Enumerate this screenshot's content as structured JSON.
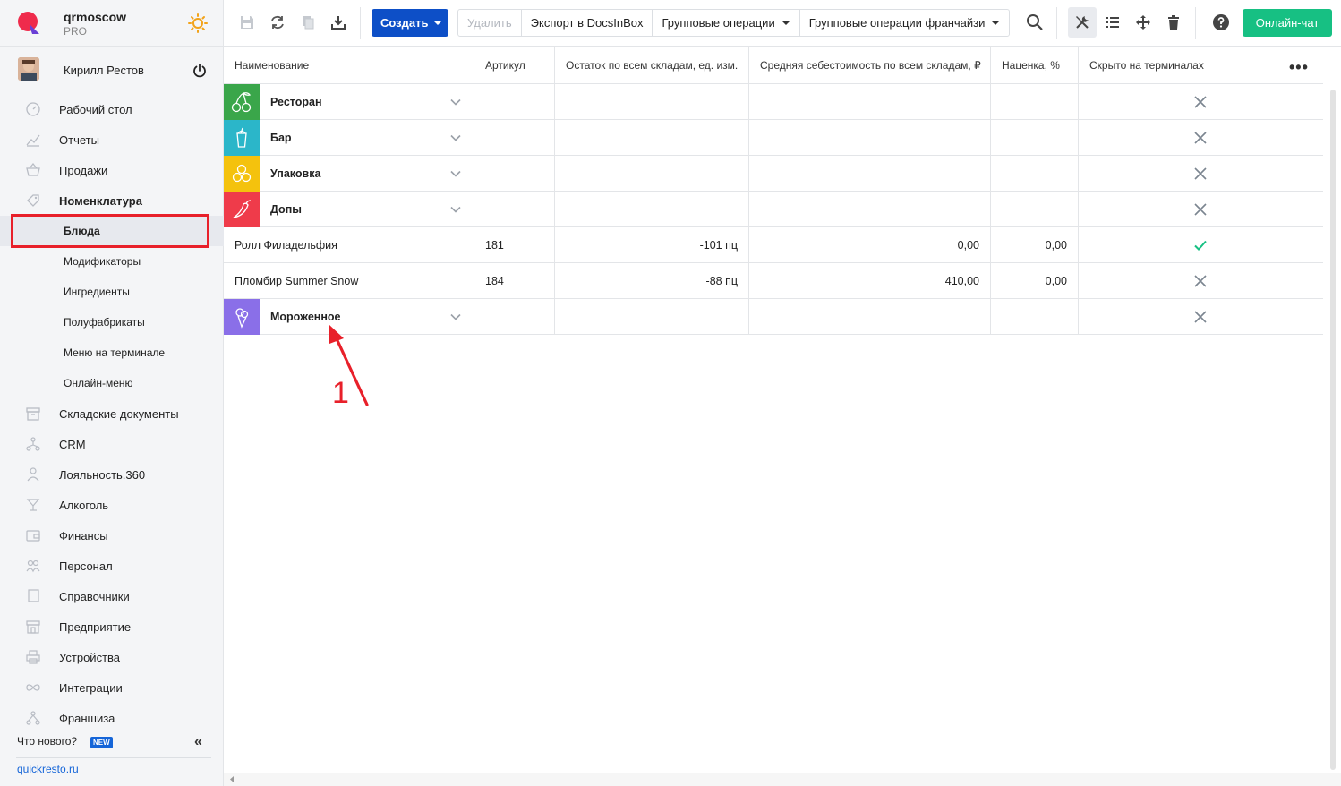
{
  "brand": {
    "name": "qrmoscow",
    "plan": "PRO"
  },
  "user": {
    "name": "Кирилл Рестов"
  },
  "nav": {
    "items": [
      {
        "label": "Рабочий стол",
        "icon": "dashboard-icon"
      },
      {
        "label": "Отчеты",
        "icon": "reports-icon"
      },
      {
        "label": "Продажи",
        "icon": "basket-icon"
      },
      {
        "label": "Номенклатура",
        "icon": "tag-icon"
      }
    ],
    "sub_items": [
      {
        "label": "Блюда"
      },
      {
        "label": "Модификаторы"
      },
      {
        "label": "Ингредиенты"
      },
      {
        "label": "Полуфабрикаты"
      },
      {
        "label": "Меню на терминале"
      },
      {
        "label": "Онлайн-меню"
      }
    ],
    "items2": [
      {
        "label": "Складские документы",
        "icon": "warehouse-icon"
      },
      {
        "label": "CRM",
        "icon": "crm-icon"
      },
      {
        "label": "Лояльность.360",
        "icon": "loyalty-icon"
      },
      {
        "label": "Алкоголь",
        "icon": "glass-icon"
      },
      {
        "label": "Финансы",
        "icon": "wallet-icon"
      },
      {
        "label": "Персонал",
        "icon": "staff-icon"
      },
      {
        "label": "Справочники",
        "icon": "book-icon"
      },
      {
        "label": "Предприятие",
        "icon": "store-icon"
      },
      {
        "label": "Устройства",
        "icon": "printer-icon"
      },
      {
        "label": "Интеграции",
        "icon": "infinity-icon"
      },
      {
        "label": "Франшиза",
        "icon": "franchise-icon"
      }
    ],
    "whats_new": "Что нового?",
    "new_badge": "NEW",
    "site": "quickresto.ru"
  },
  "toolbar": {
    "create": "Создать",
    "delete": "Удалить",
    "export": "Экспорт в DocsInBox",
    "group_ops": "Групповые операции",
    "group_ops_franchise": "Групповые операции франчайзи",
    "chat": "Онлайн-чат"
  },
  "table": {
    "headers": {
      "name": "Наименование",
      "article": "Артикул",
      "stock": "Остаток по всем складам, ед. изм.",
      "cost": "Средняя себестоимость по всем складам, ₽",
      "markup": "Наценка, %",
      "hidden": "Скрыто на терминалах"
    },
    "rows": [
      {
        "type": "category",
        "name": "Ресторан",
        "color": "#3aa64a",
        "icon": "cherries-icon",
        "article": "",
        "stock": "",
        "cost": "",
        "markup": "",
        "hidden": "x"
      },
      {
        "type": "category",
        "name": "Бар",
        "color": "#2bb6c9",
        "icon": "cocktail-icon",
        "article": "",
        "stock": "",
        "cost": "",
        "markup": "",
        "hidden": "x"
      },
      {
        "type": "category",
        "name": "Упаковка",
        "color": "#f4c20d",
        "icon": "honeycomb-icon",
        "article": "",
        "stock": "",
        "cost": "",
        "markup": "",
        "hidden": "x"
      },
      {
        "type": "category",
        "name": "Допы",
        "color": "#ef3b4a",
        "icon": "chili-icon",
        "article": "",
        "stock": "",
        "cost": "",
        "markup": "",
        "hidden": "x"
      },
      {
        "type": "item",
        "name": "Ролл Филадельфия",
        "article": "181",
        "stock": "-101 пц",
        "cost": "0,00",
        "markup": "0,00",
        "hidden": "check"
      },
      {
        "type": "item",
        "name": "Пломбир Summer Snow",
        "article": "184",
        "stock": "-88 пц",
        "cost": "410,00",
        "markup": "0,00",
        "hidden": "x"
      },
      {
        "type": "category",
        "name": "Мороженное",
        "color": "#8a6fe8",
        "icon": "ice-cream-icon",
        "article": "",
        "stock": "",
        "cost": "",
        "markup": "",
        "hidden": "x"
      }
    ]
  },
  "annotation": {
    "number": "1",
    "color": "#e8202a"
  }
}
